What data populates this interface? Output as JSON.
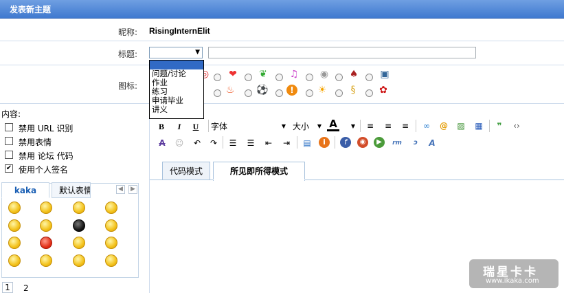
{
  "window": {
    "title": "发表新主题"
  },
  "form": {
    "nick_label": "昵称:",
    "nick_value": "RisingInternElit",
    "title_label": "标题:",
    "title_select_value": "",
    "title_options": [
      "问题/讨论",
      "作业",
      "练习",
      "申请毕业",
      "讲义"
    ],
    "title_input_value": "",
    "icon_label": "图标:",
    "icons_row1": [
      "circle-red-icon",
      "heart-icon",
      "leaf-icon",
      "music-note-icon",
      "disc-icon",
      "card-icon",
      "camera-icon"
    ],
    "icons_row2": [
      "flame-icon",
      "soccer-ball-icon",
      "exclamation-icon",
      "sun-icon",
      "scroll-icon",
      "rose-icon"
    ]
  },
  "content_panel": {
    "label": "内容:",
    "options": [
      {
        "label": "禁用  URL 识别",
        "checked": false
      },
      {
        "label": "禁用表情",
        "checked": false
      },
      {
        "label": "禁用  论坛  代码",
        "checked": false
      },
      {
        "label": "使用个人签名",
        "checked": true
      }
    ],
    "smiley_tabs": [
      "kaka",
      "默认表情"
    ],
    "active_smiley_tab": "kaka",
    "pages": [
      "1",
      "2"
    ],
    "current_page": "1"
  },
  "editor": {
    "toolbar": {
      "bold": "B",
      "italic": "I",
      "underline": "U",
      "font_label": "字体",
      "size_label": "大小",
      "color_label": "A"
    },
    "mode_tabs": [
      "代码模式",
      "所见即所得模式"
    ],
    "active_mode": "所见即所得模式",
    "body": ""
  },
  "watermark": {
    "line1": "瑞星卡卡",
    "line2": "www.ikaka.com"
  },
  "colors": {
    "title_bar": "#4a84d6",
    "accent": "#316ac5",
    "border": "#cfdced"
  }
}
